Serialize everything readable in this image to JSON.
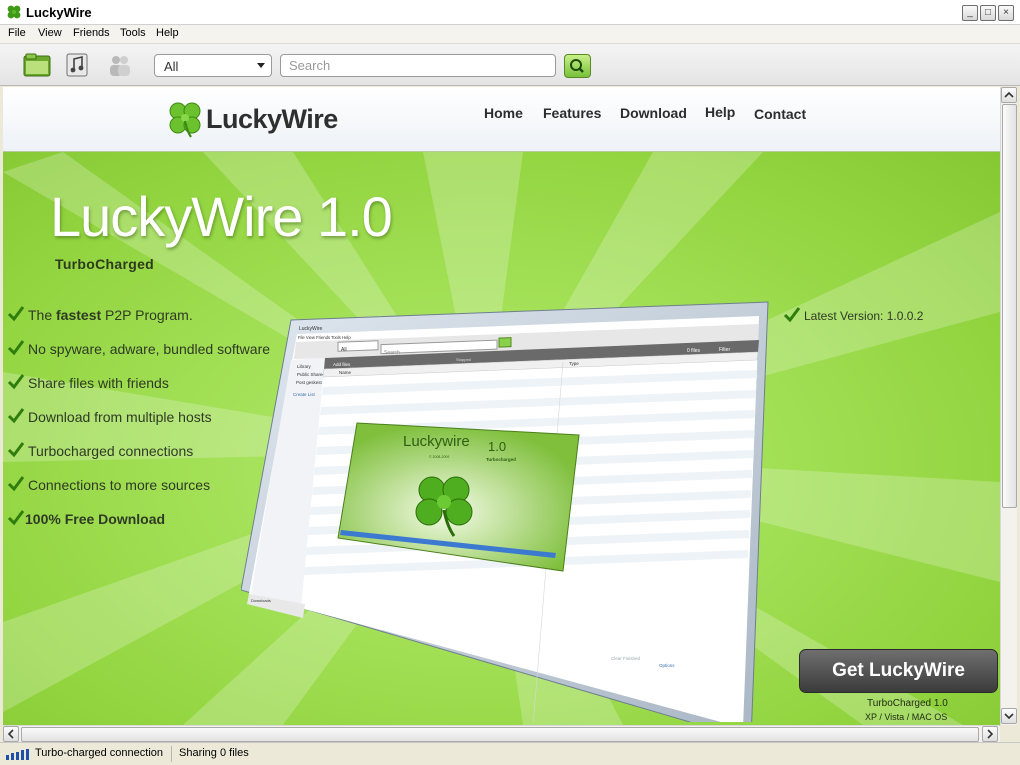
{
  "window": {
    "title": "LuckyWire"
  },
  "menu": [
    "File",
    "View",
    "Friends",
    "Tools",
    "Help"
  ],
  "toolbar": {
    "filter_value": "All",
    "search_placeholder": "Search"
  },
  "site": {
    "logo_text": "LuckyWire",
    "nav": [
      "Home",
      "Features",
      "Download",
      "Help",
      "Contact"
    ],
    "hero_title": "LuckyWire 1.0",
    "hero_subtitle": "TurboCharged",
    "features": [
      {
        "pre": "The ",
        "bold": "fastest",
        "post": " P2P Program."
      },
      {
        "pre": "No spyware, adware, bundled software",
        "bold": "",
        "post": ""
      },
      {
        "pre": "Share files with friends",
        "bold": "",
        "post": ""
      },
      {
        "pre": "Download from multiple hosts",
        "bold": "",
        "post": ""
      },
      {
        "pre": "Turbocharged connections",
        "bold": "",
        "post": ""
      },
      {
        "pre": "Connections to more sources",
        "bold": "",
        "post": ""
      },
      {
        "pre": "",
        "bold": "100% Free Download",
        "post": ""
      }
    ],
    "latest_version": "Latest Version: 1.0.0.2",
    "cta_button": "Get LuckyWire",
    "cta_sub1": "TurboCharged 1.0",
    "cta_sub2": "XP / Vista / MAC OS",
    "mock": {
      "title": "LuckyWire",
      "menu": "File  View  Friends  Tools  Help",
      "filter": "All",
      "search": "Search",
      "sidebar": [
        "Library",
        "Public Shared",
        "Post geskest",
        "Create List"
      ],
      "columns": [
        "Name",
        "Type"
      ],
      "files_count": "0 files",
      "filter_btn": "Filter",
      "add_files": "Add files",
      "stopped": "Stopped",
      "splash_title": "Luckywire",
      "splash_version": "1.0",
      "splash_copy": "© 2008-2009",
      "splash_sub": "Turbocharged",
      "downloads": "Downloads",
      "clear": "Clear Finished",
      "options": "Options"
    }
  },
  "status": {
    "connection": "Turbo-charged connection",
    "sharing": "Sharing 0 files"
  },
  "colors": {
    "hero_green": "#9cdb48",
    "button_dark": "#3b3b3b",
    "accent_green": "#78c13a"
  }
}
